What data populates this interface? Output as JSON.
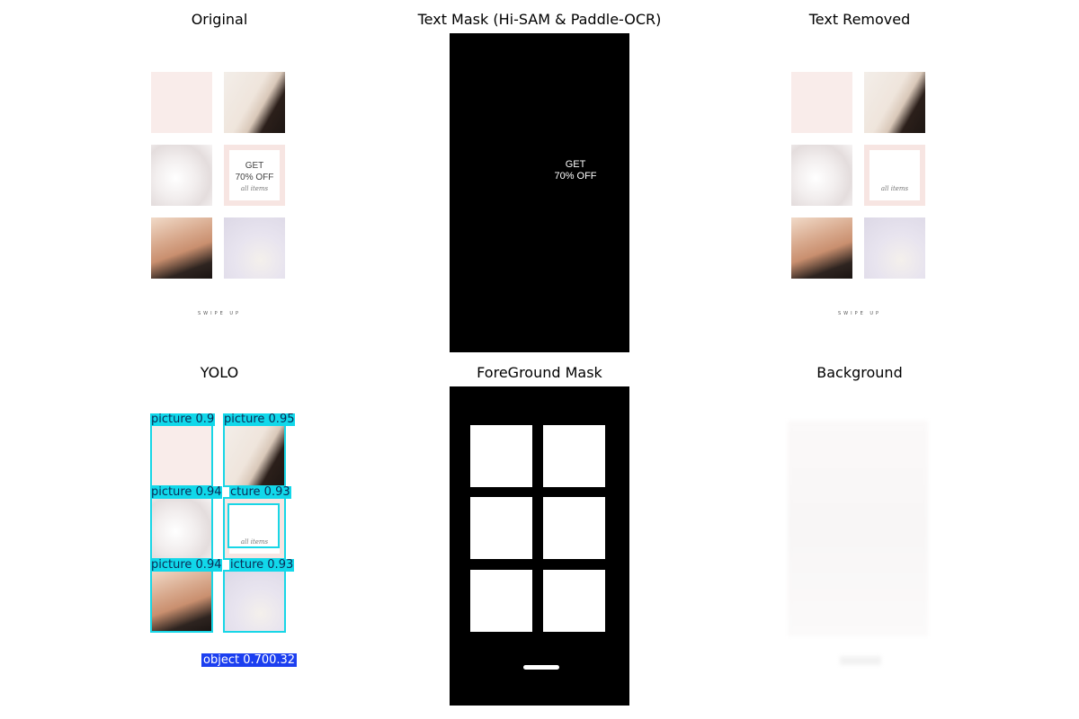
{
  "panels": {
    "original": "Original",
    "text_mask": "Text Mask (Hi-SAM & Paddle-OCR)",
    "text_removed": "Text Removed",
    "yolo": "YOLO",
    "foreground_mask": "ForeGround Mask",
    "background": "Background"
  },
  "promo": {
    "line1": "GET",
    "line2": "70% OFF",
    "script": "all items"
  },
  "mask_text": {
    "line1": "GET",
    "line2": "70% OFF"
  },
  "swipe": "SWIPE UP",
  "yolo_labels": [
    "picture 0.9",
    "picture 0.95",
    "picture 0.94",
    "cture 0.93",
    "picture 0.94",
    "icture 0.93",
    "object 0.700.32"
  ],
  "colors": {
    "detection_box": "#18d6e6",
    "object_label": "#1c3ff0",
    "tile_pink": "#f9ecea"
  },
  "icons": []
}
